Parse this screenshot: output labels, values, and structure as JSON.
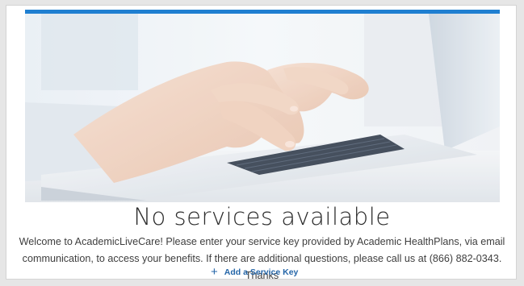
{
  "colors": {
    "accent": "#1f7fd1",
    "link": "#2566a8",
    "title": "#2b2b2b",
    "body_text": "#3e3e3e"
  },
  "hero": {
    "image": "hands-typing-on-laptop"
  },
  "main": {
    "title": "No services available",
    "welcome_line_1": "Welcome to AcademicLiveCare! Please enter your service key provided by Academic HealthPlans, via email",
    "welcome_line_2": "communication, to access your benefits. If there are additional questions, please call us at (866) 882-0343. Thanks"
  },
  "actions": {
    "add_key_icon": "plus-icon",
    "add_key_label": "Add a Service Key"
  }
}
